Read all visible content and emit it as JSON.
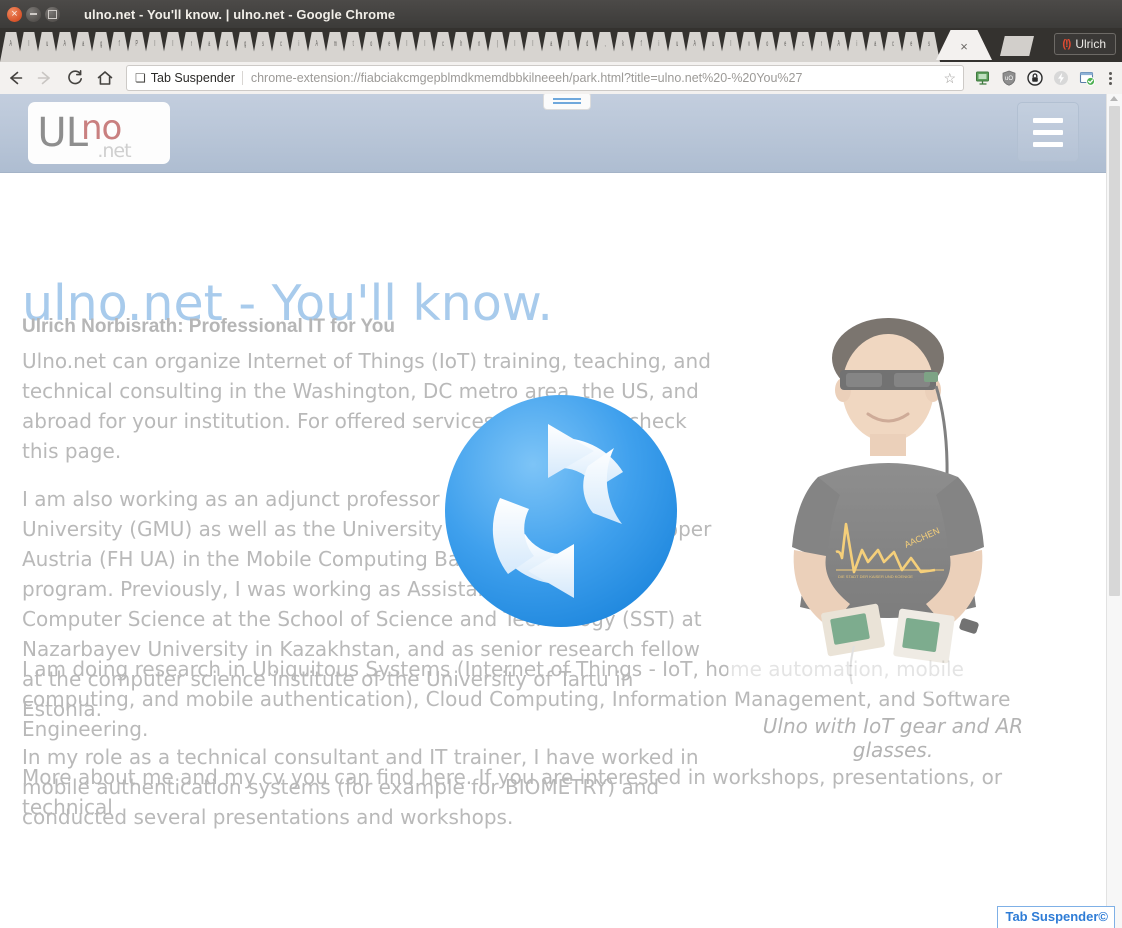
{
  "window": {
    "title": "ulno.net - You'll know. | ulno.net - Google Chrome",
    "controls": {
      "close": "close-window",
      "minimize": "minimize-window",
      "maximize": "maximize-window"
    }
  },
  "tabstrip": {
    "active_tab_close": "×",
    "new_tab_label": "",
    "user": {
      "label": "Ulrich",
      "icon": "incognito-person-icon"
    },
    "tab_glyphs": [
      "A",
      "l",
      "u",
      "A",
      "a",
      "g",
      "f",
      "P",
      "l",
      "l",
      "r",
      "a",
      "d",
      "g",
      "s",
      "c",
      "i",
      "A",
      "m",
      "t",
      "o",
      "e",
      "l",
      "l",
      "c",
      "h",
      "n",
      "(",
      "l",
      "l",
      "a",
      "l",
      "d",
      ",",
      "k",
      "f",
      "i",
      "u",
      "A",
      "u",
      "l",
      "v",
      "o",
      "e",
      "c",
      "r",
      "A",
      "i",
      "a",
      "c",
      "e",
      "s",
      "l",
      "o",
      "t",
      "i",
      "o",
      "n",
      "s",
      "e",
      "A",
      "m",
      "n",
      "l",
      "d",
      "A",
      "u",
      "e",
      "r",
      "p",
      "a",
      "e",
      "c",
      "t",
      "i",
      "o",
      "A",
      "e",
      "s",
      "A",
      "l",
      "n",
      "l",
      "A",
      "u",
      "o",
      "r",
      "t",
      "c",
      "e"
    ]
  },
  "toolbar": {
    "back": "back-arrow",
    "forward": "forward-arrow",
    "reload": "reload-arrow",
    "home": "home-icon",
    "extension_chip": "Tab Suspender",
    "url": "chrome-extension://fiabciakcmgepblmdkmemdbbkilneeeh/park.html?title=ulno.net%20-%20You%27",
    "star": "☆",
    "icons": [
      "remote-desktop-icon",
      "ublock-shield-icon",
      "privacy-lock-icon",
      "lightning-bolt-icon",
      "window-check-icon"
    ],
    "menu": "three-dot-menu"
  },
  "page": {
    "logo": {
      "ul": "UL",
      "no": "no",
      "net": ".net"
    },
    "menu_button": "hamburger-menu",
    "heading": "ulno.net - You'll know.",
    "subheading": "Ulrich Norbisrath: Professional IT for You",
    "paragraphs": [
      {
        "parts": [
          {
            "t": "Ulno.net can organize ",
            "link": false
          },
          {
            "t": "Internet of Things (IoT)",
            "link": true
          },
          {
            "t": " training, teaching, and technical consulting in the Washington, DC metro area, the US, and abroad for your institution. For offered services and courses check ",
            "link": false
          },
          {
            "t": "this page",
            "link": true
          },
          {
            "t": ".",
            "link": false
          }
        ]
      },
      {
        "parts": [
          {
            "t": "I am also working as an adjunct professor at ",
            "link": false
          },
          {
            "t": "George Mason University (GMU)",
            "link": true
          },
          {
            "t": " as well as the ",
            "link": false
          },
          {
            "t": "University of Applied Sciences Upper Austria (FH UA)",
            "link": true
          },
          {
            "t": " in the ",
            "link": false
          },
          {
            "t": "Mobile Computing Bachelor and Master program",
            "link": true
          },
          {
            "t": ". Previously, I was working as Assistant Professor for Computer Science at the ",
            "link": false
          },
          {
            "t": "School of Science and Technology (SST)",
            "link": true
          },
          {
            "t": " at ",
            "link": false
          },
          {
            "t": "Nazarbayev University",
            "link": true
          },
          {
            "t": " in Kazakhstan, and as senior research fellow at the ",
            "link": false
          },
          {
            "t": "computer science institute",
            "link": true
          },
          {
            "t": " of the ",
            "link": false
          },
          {
            "t": "University of Tartu",
            "link": true
          },
          {
            "t": " in Estonia.",
            "link": false
          }
        ]
      },
      {
        "parts": [
          {
            "t": "In my role as a technical ",
            "link": false
          },
          {
            "t": "consultant",
            "link": true
          },
          {
            "t": " and ",
            "link": false
          },
          {
            "t": "IT trainer",
            "link": true
          },
          {
            "t": ", I have worked in mobile authentication systems (for example for ",
            "link": false
          },
          {
            "t": "BIOMETRY)",
            "link": true
          },
          {
            "t": " and conducted several ",
            "link": false
          },
          {
            "t": "presentations and workshops",
            "link": true
          },
          {
            "t": ".",
            "link": false
          }
        ]
      }
    ],
    "paragraphs_wide": [
      {
        "parts": [
          {
            "t": "I am doing research in ",
            "link": false
          },
          {
            "t": "Ubiquitous Systems",
            "link": true
          },
          {
            "t": " (Internet of Things - ",
            "link": false
          },
          {
            "t": "IoT",
            "link": true
          },
          {
            "t": ", ",
            "link": false
          },
          {
            "t": "home automation",
            "link": true
          },
          {
            "t": ", mobile computing, and mobile authentication), ",
            "link": false
          },
          {
            "t": "Cloud Computing",
            "link": true
          },
          {
            "t": ", ",
            "link": false
          },
          {
            "t": "Information Management",
            "link": true
          },
          {
            "t": ", and ",
            "link": false
          },
          {
            "t": "Software Engineering",
            "link": true
          },
          {
            "t": ".",
            "link": false
          }
        ]
      },
      {
        "parts": [
          {
            "t": "More about me and my cv you can find ",
            "link": false
          },
          {
            "t": "here",
            "link": true
          },
          {
            "t": ". If you are interested in workshops, presentations, or technical",
            "link": false
          }
        ]
      }
    ],
    "caption": {
      "parts": [
        {
          "t": "Ulno with ",
          "link": false
        },
        {
          "t": "IoT",
          "link": true
        },
        {
          "t": " gear and ",
          "link": false
        },
        {
          "t": "AR",
          "link": true
        },
        {
          "t": " glasses.",
          "link": false
        }
      ]
    },
    "photo_alt": "man-with-ar-glasses-holding-raspberry-pi-boards",
    "overlay_icon": "refresh-circle-icon"
  },
  "overlay_badge": {
    "label": "Tab Suspender©"
  },
  "colors": {
    "accent_link": "#a9cfee",
    "heading": "#a8cbec",
    "body_text": "#b9b9b9",
    "banner_top": "#c3cede",
    "banner_bottom": "#aebdd1",
    "logo_no": "#c98080",
    "badge_blue": "#2e7cd6",
    "refresh_blue": "#3fa0ed",
    "titlebar": "#3c3b39"
  },
  "scrollbar": {
    "orientation": "vertical",
    "thumb_position_pct": 1
  }
}
